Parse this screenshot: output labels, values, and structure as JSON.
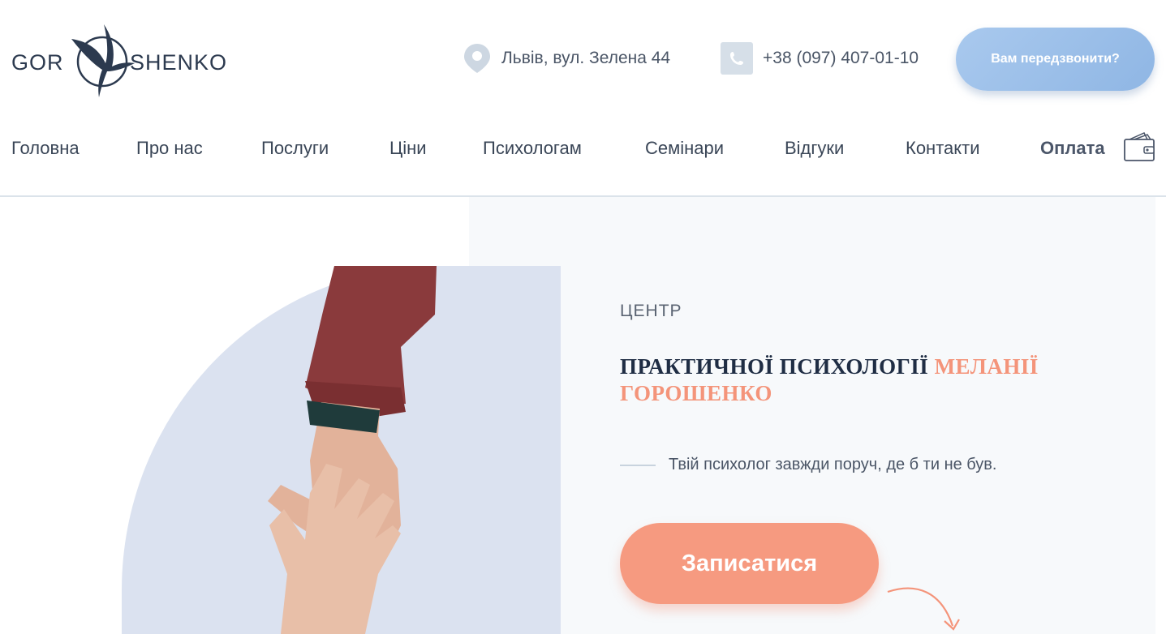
{
  "header": {
    "logo": {
      "left": "GOR",
      "right": "SHENKO"
    },
    "address": "Львів, вул. Зелена 44",
    "phone": "+38 (097) 407-01-10",
    "callback_label": "Вам передзвонити?"
  },
  "nav": {
    "items": [
      "Головна",
      "Про нас",
      "Послуги",
      "Ціни",
      "Психологам",
      "Семінари",
      "Відгуки",
      "Контакти"
    ],
    "pay_label": "Оплата"
  },
  "hero": {
    "eyebrow": "ЦЕНТР",
    "title_main": "ПРАКТИЧНОЇ ПСИХОЛОГІЇ ",
    "title_accent": "МЕЛАНІЇ ГОРОШЕНКО",
    "tagline": "Твій психолог завжди поруч, де б ти не був.",
    "signup_label": "Записатися"
  },
  "colors": {
    "accent": "#f69a80",
    "callback": "#9dbfe9",
    "hero_bg": "#f7f9fb",
    "image_bg": "#dbe2f0"
  }
}
